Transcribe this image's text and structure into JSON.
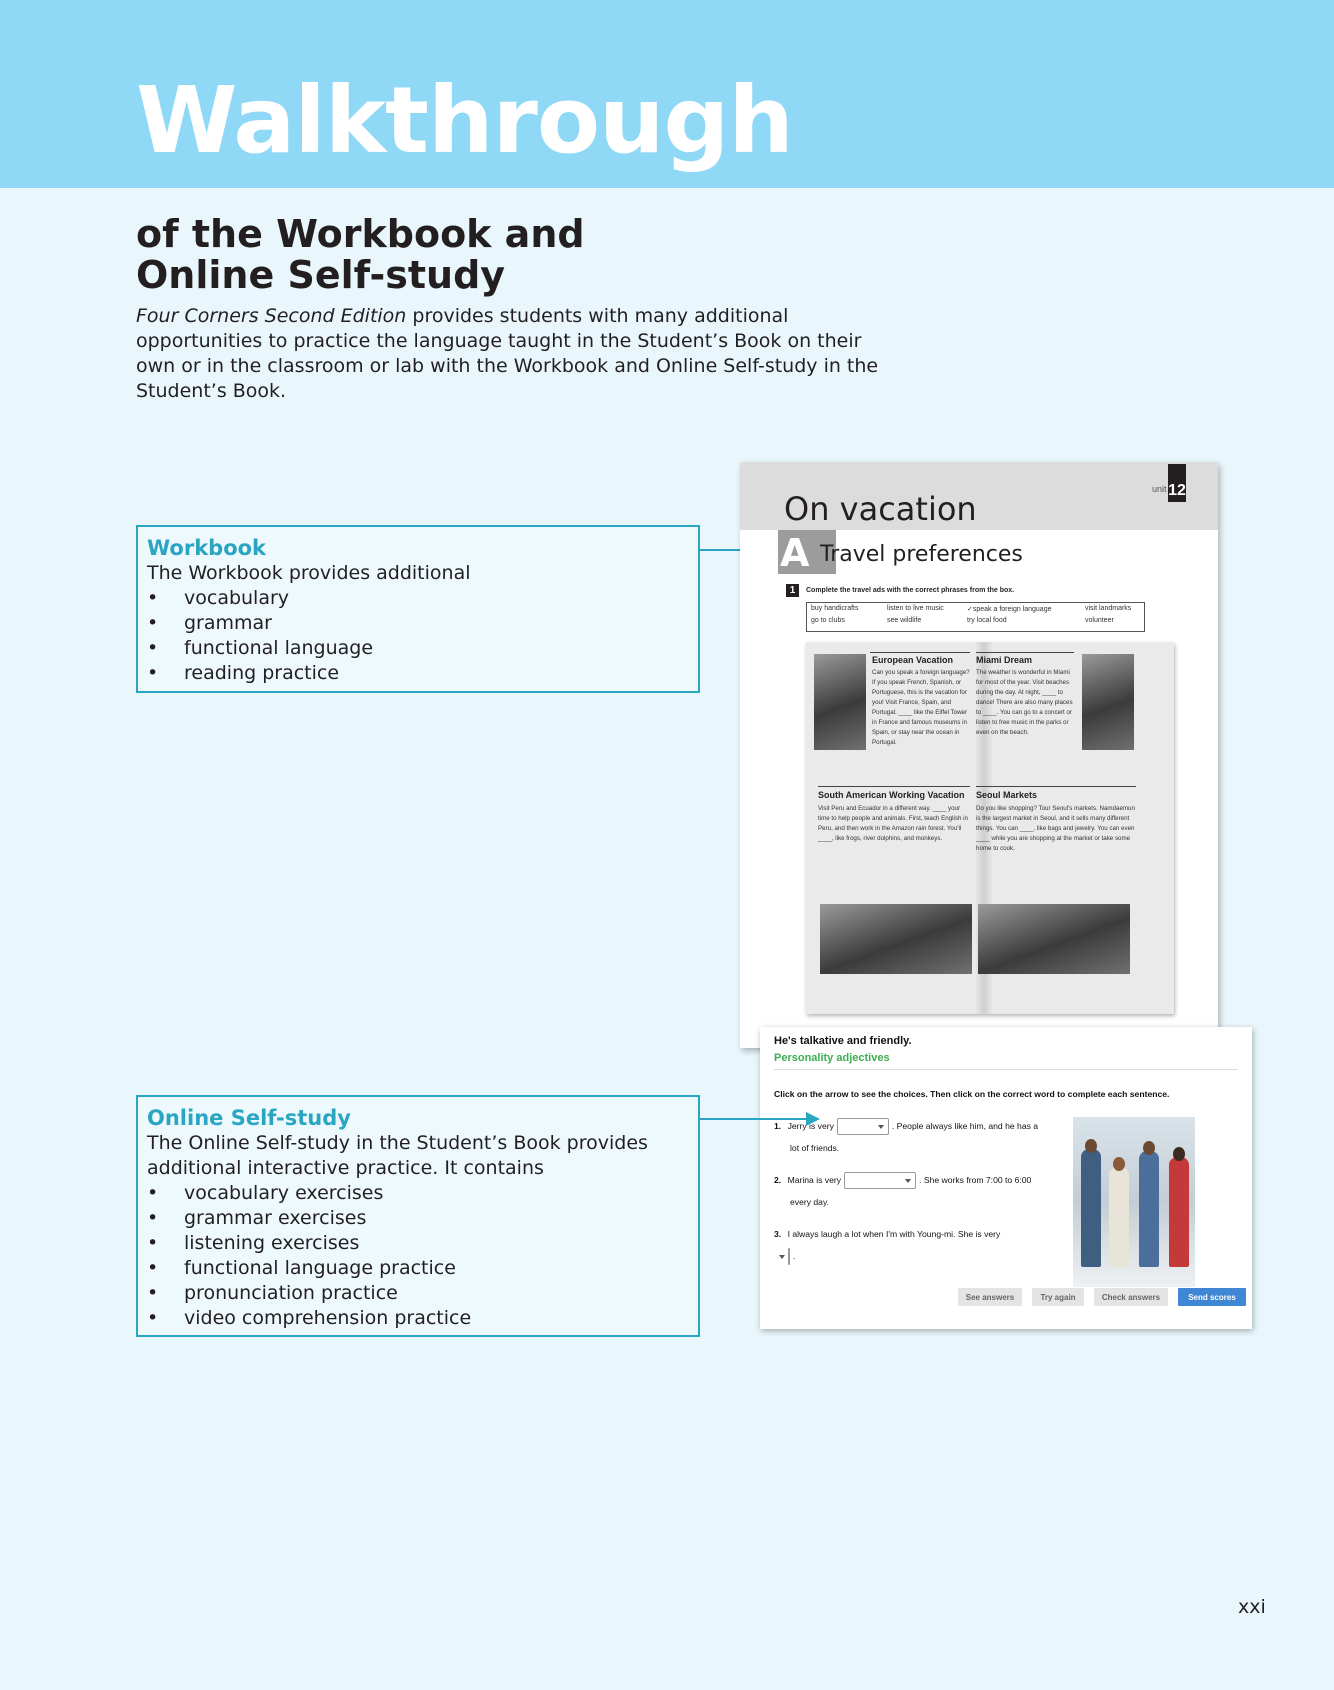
{
  "banner": {
    "title": "Walkthrough"
  },
  "subtitle": {
    "line1": "of the Workbook and",
    "line2": "Online Self-study"
  },
  "intro": {
    "italic": "Four Corners Second Edition",
    "text": " provides students with many additional opportunities to practice the language taught in the Student’s Book on their own or in the classroom or lab with the Workbook and Online Self-study in the Student’s Book."
  },
  "workbook_callout": {
    "heading": "Workbook",
    "lead": "The Workbook provides additional",
    "items": [
      "vocabulary",
      "grammar",
      "functional language",
      "reading practice"
    ]
  },
  "online_callout": {
    "heading": "Online Self-study",
    "lead": "The Online Self-study in the Student’s Book provides additional interactive practice. It contains",
    "items": [
      "vocabulary exercises",
      "grammar exercises",
      "listening exercises",
      "functional language practice",
      "pronunciation practice",
      "video comprehension practice"
    ]
  },
  "workbook_page": {
    "unit_label": "unit",
    "unit_number": "12",
    "title": "On vacation",
    "lesson_letter": "A",
    "lesson_title": "Travel preferences",
    "exercise_number": "1",
    "instruction": "Complete the travel ads with the correct phrases from the box.",
    "word_box": [
      "buy handicrafts",
      "listen to live music",
      "✓speak a foreign language",
      "visit landmarks",
      "go to clubs",
      "see wildlife",
      "try local food",
      "volunteer"
    ],
    "ads": [
      {
        "title": "European Vacation",
        "text": "Can you speak a foreign language? If you speak French, Spanish, or Portuguese, this is the vacation for you! Visit France, Spain, and Portugal. ____ like the Eiffel Tower in France and famous museums in Spain, or stay near the ocean in Portugal."
      },
      {
        "title": "Miami Dream",
        "text": "The weather is wonderful in Miami for most of the year. Visit beaches during the day. At night, ____ to dance! There are also many places to ____. You can go to a concert or listen to free music in the parks or even on the beach."
      },
      {
        "title": "South American Working Vacation",
        "text": "Visit Peru and Ecuador in a different way. ____ your time to help people and animals. First, teach English in Peru, and then work in the Amazon rain forest. You'll ____, like frogs, river dolphins, and monkeys."
      },
      {
        "title": "Seoul Markets",
        "text": "Do you like shopping? Tour Seoul's markets. Namdaemun is the largest market in Seoul, and it sells many different things. You can ____, like bags and jewelry. You can even ____ while you are shopping at the market or take some home to cook."
      }
    ]
  },
  "online_page": {
    "title": "He's talkative and friendly.",
    "subtitle": "Personality adjectives",
    "instruction": "Click on the arrow to see the choices. Then click on the correct word to complete each sentence.",
    "questions": [
      {
        "num": "1.",
        "before": "Jerry is very",
        "after": ". People always like him, and he has a",
        "line2": "lot of friends."
      },
      {
        "num": "2.",
        "before": "Marina is very",
        "after": ". She works from 7:00 to 6:00",
        "line2": "every day."
      },
      {
        "num": "3.",
        "before": "I always laugh a lot when I'm with Young-mi. She is very",
        "after": "",
        "line2": "."
      }
    ],
    "buttons": [
      "See answers",
      "Try again",
      "Check answers",
      "Send scores"
    ]
  },
  "page_number": "xxi",
  "colors": {
    "banner": "#8fd8f6",
    "background": "#e9f7fd",
    "accent": "#2aa6c3",
    "adjective_green": "#3cae4f",
    "send_button": "#3f87d4"
  }
}
